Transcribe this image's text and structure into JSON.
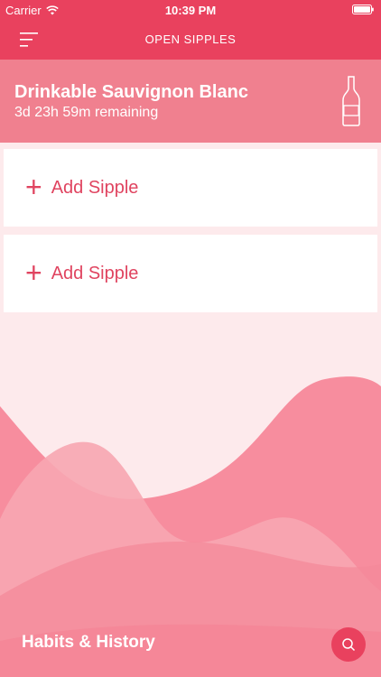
{
  "status_bar": {
    "carrier": "Carrier",
    "time": "10:39 PM",
    "wifi_icon": "wifi-icon",
    "battery_icon": "battery-icon"
  },
  "nav": {
    "menu_icon": "hamburger-menu-icon",
    "title": "OPEN SIPPLES"
  },
  "sipple": {
    "name": "Drinkable Sauvignon Blanc",
    "remaining": "3d 23h 59m remaining",
    "icon": "wine-bottle-icon"
  },
  "add_cards": [
    {
      "label": "Add Sipple",
      "icon": "plus-icon"
    },
    {
      "label": "Add Sipple",
      "icon": "plus-icon"
    }
  ],
  "footer": {
    "title": "Habits & History",
    "search_icon": "search-icon"
  },
  "colors": {
    "primary": "#e9415e",
    "header": "#f0808f",
    "background": "#fdeaec",
    "accent_text": "#e04460"
  }
}
